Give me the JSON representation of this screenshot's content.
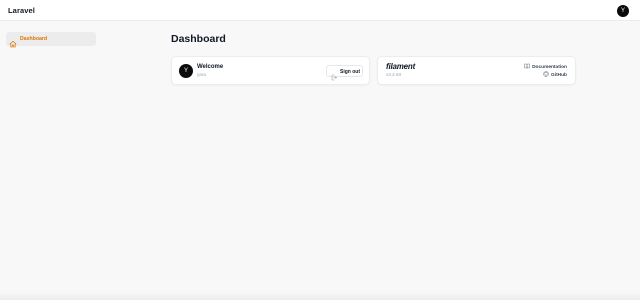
{
  "header": {
    "brand": "Laravel",
    "user_initial": "Y"
  },
  "sidebar": {
    "items": [
      {
        "label": "Dashboard",
        "icon": "home-icon",
        "active": true
      }
    ]
  },
  "main": {
    "title": "Dashboard",
    "welcome_card": {
      "avatar_initial": "Y",
      "title": "Welcome",
      "subtitle": "yara",
      "signout_label": "Sign out"
    },
    "filament_card": {
      "logo": "filament",
      "version": "v3.2.93",
      "docs_label": "Documentation",
      "github_label": "GitHub"
    }
  },
  "colors": {
    "accent": "#d97706",
    "background": "#f8f8f8",
    "avatar": "#0b0b0b"
  }
}
